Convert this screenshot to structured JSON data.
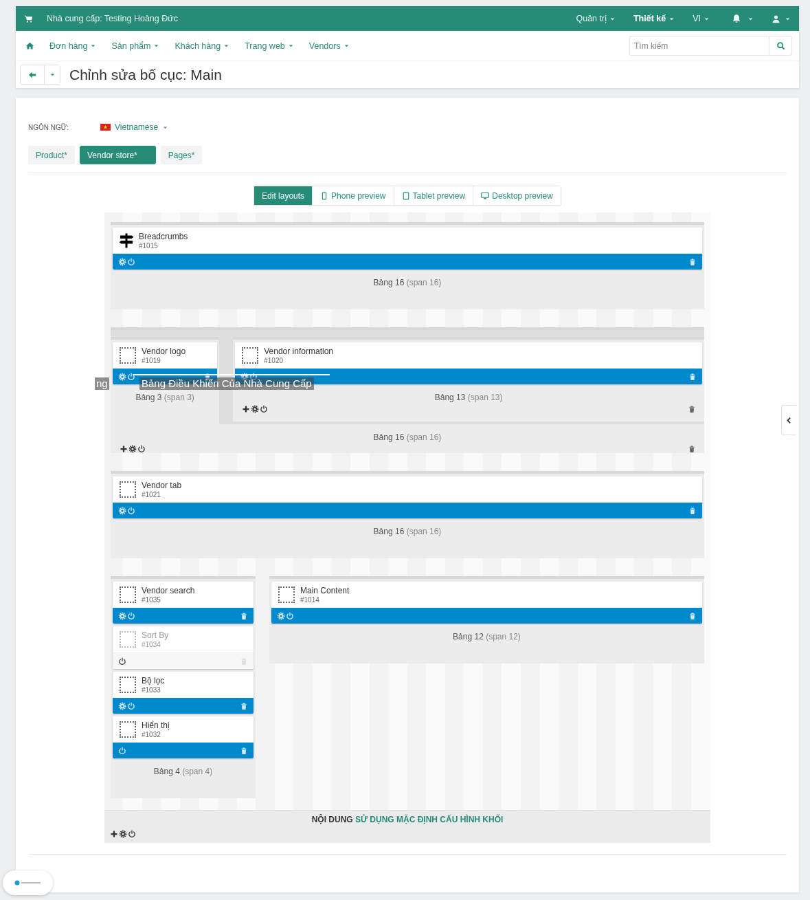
{
  "top_bar": {
    "vendor_label": "Nhà cung cấp: Testing Hoàng Đức",
    "menus": [
      {
        "label": "Quản trị",
        "selected": false
      },
      {
        "label": "Thiết kế",
        "selected": true
      },
      {
        "label": "VI",
        "selected": false
      }
    ]
  },
  "nav": {
    "items": [
      "Đơn hàng",
      "Sản phẩm",
      "Khách hàng",
      "Trang web",
      "Vendors"
    ],
    "search": {
      "placeholder": "Tìm kiếm"
    }
  },
  "page_title": "Chỉnh sửa bố cục: Main",
  "language": {
    "label": "NGÔN NGỮ:",
    "value": "Vietnamese"
  },
  "layout_tabs": [
    {
      "label": "Product*",
      "selected": false
    },
    {
      "label": "Vendor store*",
      "selected": true
    },
    {
      "label": "Pages*",
      "selected": false
    }
  ],
  "view_modes": [
    {
      "kind": "edit",
      "label": "Edit layouts",
      "selected": true
    },
    {
      "kind": "phone",
      "label": "Phone preview",
      "selected": false
    },
    {
      "kind": "tablet",
      "label": "Tablet preview",
      "selected": false
    },
    {
      "kind": "desktop",
      "label": "Desktop preview",
      "selected": false
    }
  ],
  "grids": [
    [
      {
        "title": "Bảng 16",
        "span": "(span 16)",
        "blocks": [
          {
            "name": "Breadcrumbs",
            "id": "#1015",
            "kind": "signpost",
            "enabled": true,
            "settings": true
          }
        ]
      }
    ],
    [
      {
        "title": "Bảng 16",
        "span": "(span 16)",
        "toolbar": true,
        "children": [
          {
            "title": "Bảng 3",
            "span": "(span 3)",
            "blocks": [
              {
                "name": "Vendor logo",
                "id": "#1019",
                "kind": "placeholder",
                "enabled": true,
                "settings": true
              }
            ]
          },
          {
            "title": "Bảng 13",
            "span": "(span 13)",
            "toolbar": true,
            "blocks": [
              {
                "name": "Vendor information",
                "id": "#1020",
                "kind": "placeholder",
                "enabled": true,
                "settings": true
              }
            ]
          }
        ]
      }
    ],
    [
      {
        "title": "Bảng 16",
        "span": "(span 16)",
        "blocks": [
          {
            "name": "Vendor tab",
            "id": "#1021",
            "kind": "placeholder",
            "enabled": true,
            "settings": true
          }
        ]
      }
    ],
    [
      {
        "title": "Bảng 4",
        "span": "(span 4)",
        "blocks": [
          {
            "name": "Vendor search",
            "id": "#1035",
            "kind": "placeholder",
            "enabled": true,
            "settings": true
          },
          {
            "name": "Sort By",
            "id": "#1034",
            "kind": "placeholder",
            "enabled": false,
            "settings": false
          },
          {
            "name": "Bộ lọc",
            "id": "#1033",
            "kind": "placeholder",
            "enabled": true,
            "settings": true
          },
          {
            "name": "Hiển thị",
            "id": "#1032",
            "kind": "placeholder",
            "enabled": true,
            "settings": false
          }
        ]
      },
      {
        "title": "Bảng 12",
        "span": "(span 12)",
        "blocks": [
          {
            "name": "Main Content",
            "id": "#1014",
            "kind": "placeholder",
            "enabled": true,
            "settings": true
          }
        ]
      }
    ]
  ],
  "overlay": {
    "fragment": "ng",
    "caption": "Bảng Điều Khiển Của Nhà Cung Cấp"
  },
  "footer": {
    "label": "NỘI DUNG",
    "link": "SỬ DỤNG MẶC ĐỊNH CẤU HÌNH KHỐI"
  }
}
